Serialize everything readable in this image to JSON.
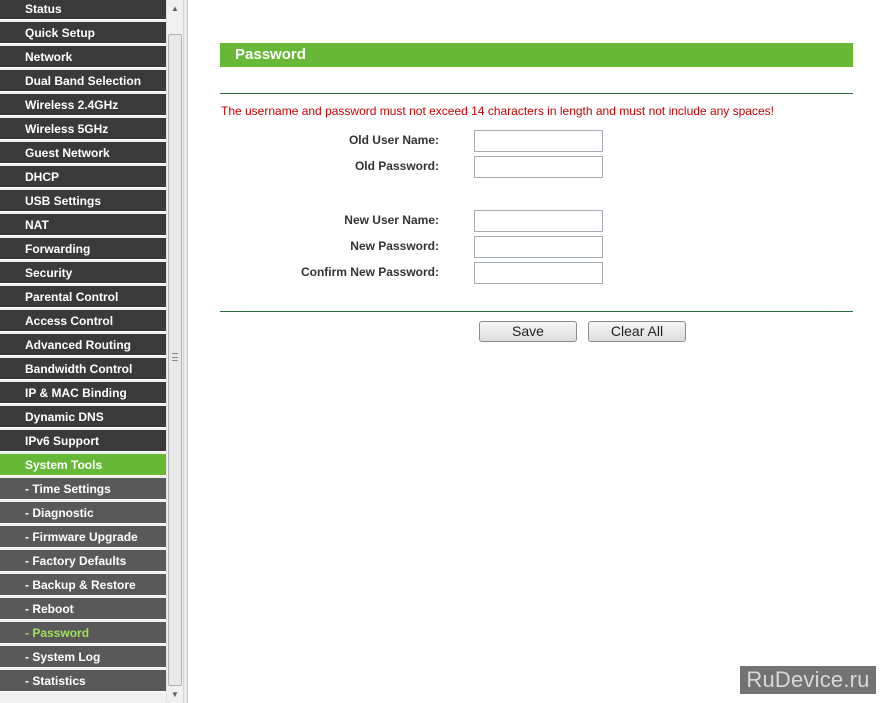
{
  "sidebar": {
    "items": [
      {
        "label": "Status",
        "kind": "top"
      },
      {
        "label": "Quick Setup",
        "kind": "top"
      },
      {
        "label": "Network",
        "kind": "top"
      },
      {
        "label": "Dual Band Selection",
        "kind": "top"
      },
      {
        "label": "Wireless 2.4GHz",
        "kind": "top"
      },
      {
        "label": "Wireless 5GHz",
        "kind": "top"
      },
      {
        "label": "Guest Network",
        "kind": "top"
      },
      {
        "label": "DHCP",
        "kind": "top"
      },
      {
        "label": "USB Settings",
        "kind": "top"
      },
      {
        "label": "NAT",
        "kind": "top"
      },
      {
        "label": "Forwarding",
        "kind": "top"
      },
      {
        "label": "Security",
        "kind": "top"
      },
      {
        "label": "Parental Control",
        "kind": "top"
      },
      {
        "label": "Access Control",
        "kind": "top"
      },
      {
        "label": "Advanced Routing",
        "kind": "top"
      },
      {
        "label": "Bandwidth Control",
        "kind": "top"
      },
      {
        "label": "IP & MAC Binding",
        "kind": "top"
      },
      {
        "label": "Dynamic DNS",
        "kind": "top"
      },
      {
        "label": "IPv6 Support",
        "kind": "top"
      },
      {
        "label": "System Tools",
        "kind": "selected-parent"
      },
      {
        "label": "- Time Settings",
        "kind": "sub"
      },
      {
        "label": "- Diagnostic",
        "kind": "sub"
      },
      {
        "label": "- Firmware Upgrade",
        "kind": "sub"
      },
      {
        "label": "- Factory Defaults",
        "kind": "sub"
      },
      {
        "label": "- Backup & Restore",
        "kind": "sub"
      },
      {
        "label": "- Reboot",
        "kind": "sub"
      },
      {
        "label": "- Password",
        "kind": "sub active"
      },
      {
        "label": "- System Log",
        "kind": "sub"
      },
      {
        "label": "- Statistics",
        "kind": "sub"
      }
    ]
  },
  "page": {
    "title": "Password",
    "warning": "The username and password must not exceed 14 characters in length and must not include any spaces!"
  },
  "form": {
    "old_user_name_label": "Old User Name:",
    "old_password_label": "Old Password:",
    "new_user_name_label": "New User Name:",
    "new_password_label": "New Password:",
    "confirm_password_label": "Confirm New Password:",
    "old_user_name_value": "",
    "old_password_value": "",
    "new_user_name_value": "",
    "new_password_value": "",
    "confirm_password_value": ""
  },
  "buttons": {
    "save_label": "Save",
    "clear_label": "Clear All"
  },
  "watermark": {
    "text": "RuDevice.ru"
  },
  "colors": {
    "menu_bg": "#3a3a3a",
    "submenu_bg": "#595959",
    "accent_green": "#66b836",
    "active_text": "#9fe15c",
    "warning_red": "#cc0000",
    "divider_green": "#2e6b3a"
  },
  "icons": {
    "scroll_up": "up-arrow-icon",
    "scroll_down": "down-arrow-icon"
  }
}
